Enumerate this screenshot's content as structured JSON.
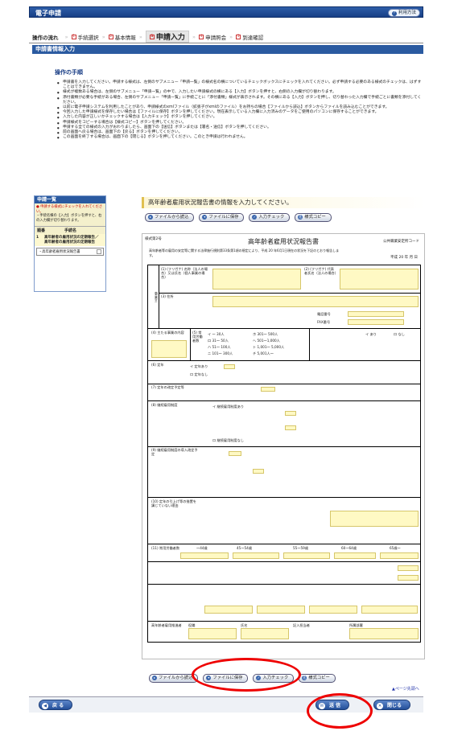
{
  "header": {
    "title": "電子申請",
    "help_label": "利用方法",
    "help_icon": "question-icon"
  },
  "flow": {
    "label": "操作の流れ",
    "steps": [
      {
        "num": "1",
        "label": "手続選択"
      },
      {
        "num": "2",
        "label": "基本情報"
      },
      {
        "num": "3",
        "label": "申請入力"
      },
      {
        "num": "4",
        "label": "申請照会"
      },
      {
        "num": "5",
        "label": "到達確認"
      }
    ]
  },
  "section_title": "申請書情報入力",
  "instructions": {
    "title": "操作の手順",
    "items": [
      "申請書を入力してください。申請する様式は、左側のサブメニュー「申請一覧」の様式名の横についているチェックボックスにチェックを入れてください。必ず申請する必要のある様式のチェックは、はずすことはできません。",
      "様式が複数ある場合は、左側のサブメニュー「申請一覧」の中で、入力したい申請様式の横にある【入力】ボタンを押すと、右側の入力欄が切り替わります。",
      "添付書類が必要な手続がある場合、左側のサブメニュー「申請一覧」に手続ごとに「添付書類」様式が表示されます。その横にある【入力】ボタンを押し、切り替わった入力欄で手続ごとに書類を添付してください。",
      "以前に電子申請システムを利用したことがあり、申請様式のxmlファイル（拡張子がxmlのファイル）をお持ちの場合【ファイルから読込】ボタンからファイルを読み込むことができます。",
      "今回入力した申請様式を保存したい場合は【ファイルに保存】ボタンを押してください。現在表示している入力欄に入力済みのデータをご使用のパソコンに保存することができます。",
      "入力した内容が正しいかチェックする場合は【入力チェック】ボタンを押してください。",
      "申請様式をコピーする場合は【様式コピー】ボタンを押してください。",
      "申請する全ての様式の入力がおわりましたら、画面下の【送信】ボタンまたは【署名・送信】ボタンを押してください。",
      "前の画面へ戻る場合は、画面下の【戻る】ボタンを押してください。",
      "この画面を終了する場合は、画面下の【閉じる】ボタンを押してください。このとき申請は行われません。"
    ]
  },
  "sidebar": {
    "title": "申請一覧",
    "warning_lines": [
      "● 申請する様式にチェックを入れてください。",
      "・手続名横の【入力】ボタンを押すと、右の入力欄が切り替わります。"
    ],
    "col_order": "順番",
    "col_name": "手続名",
    "entry_index": "1",
    "entry_name": "高年齢者の雇用状況の定期報告／高年齢者の雇用状況の定期報告",
    "sub_item": "・高年齢者雇用状況報告書"
  },
  "form_headline": "高年齢者雇用状況報告書の情報を入力してください。",
  "toolbar": {
    "load": "ファイルから読込",
    "save": "ファイルに保存",
    "check": "入力チェック",
    "copy": "様式コピー"
  },
  "doc": {
    "corner": "様式第2号",
    "title": "高年齢者雇用状況報告書",
    "code": "公共職業安定所コード",
    "note": "高年齢者等の雇用の安定等に関する法律施行規則第33条第1項の規定により、平成 20 年6月1日現在の状況を下記のとおり報告します。",
    "date": "平成 20 年 月 日",
    "labels": {
      "employer": "事業主",
      "owner": "(1) (フリガナ) 名称（法人の場合）又は氏名（個人事業の場合）",
      "rep": "(2) (フリガナ) 代表者氏名（法人の場合）",
      "address": "(3) 住所",
      "industry": "(4) 主たる事業の内容",
      "employees": "(5) 常用労働者数",
      "limit": "(6) 定年",
      "retirement": "(7) 定年の改定予定等",
      "sys": "(8) 継続雇用制度",
      "sys2": "(9) 継続雇用制度の導入改定予定",
      "reason": "(10) 定年の引上げ等の措置を講じていない理由",
      "count": "(11) 常用労働者数",
      "tel": "電話番号",
      "fax": "FAX番号"
    },
    "opts": {
      "emp1": "イ 〜 30人",
      "emp2": "ロ 31〜 50人",
      "emp3": "ハ 51〜 100人",
      "emp4": "ニ 101〜 300人",
      "emp5": "ホ 301〜 500人",
      "emp6": "ヘ 501〜1,000人",
      "emp7": "ト 1,001〜 5,000人",
      "emp8": "チ 5,001人〜",
      "ari": "イ あり",
      "nashi": "ロ なし",
      "teinen1": "イ 定年あり",
      "teinen2": "ロ 定年なし",
      "sys_ari": "イ 継続雇用制度あり",
      "sys_nashi": "ロ 継続雇用制度なし"
    },
    "sigrow": {
      "a": "高年齢者雇用推進者",
      "b": "役職",
      "c": "氏名",
      "d": "所属部署",
      "e": "電話",
      "f": "記入担当者"
    },
    "counts": [
      "〜44歳",
      "45〜54歳",
      "55〜59歳",
      "60〜64歳",
      "65歳〜"
    ]
  },
  "back_to_top": "▲ページ先頭へ",
  "bottom": {
    "back": "戻 る",
    "send": "送 信",
    "close": "閉じる"
  }
}
